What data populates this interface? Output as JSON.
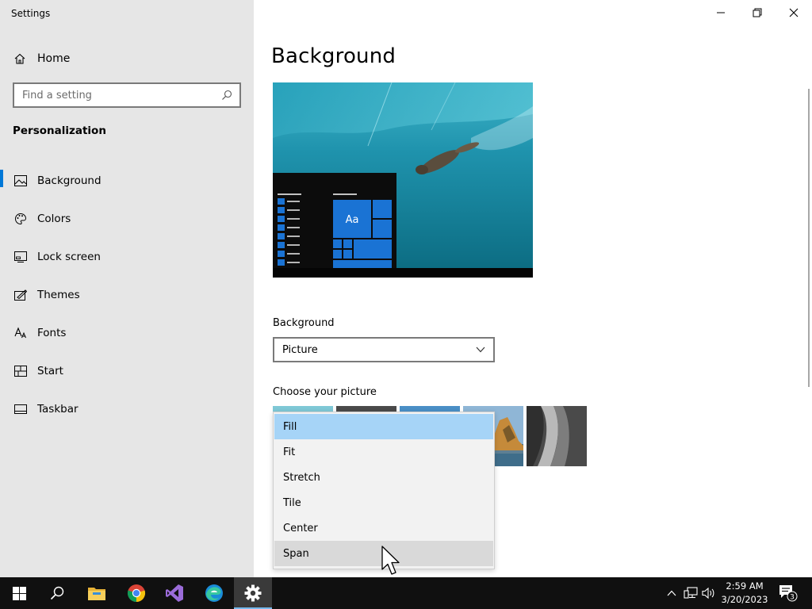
{
  "window": {
    "title": "Settings",
    "controls": [
      "minimize",
      "maximize",
      "close"
    ]
  },
  "sidebar": {
    "home_label": "Home",
    "search_placeholder": "Find a setting",
    "section_title": "Personalization",
    "items": [
      {
        "label": "Background",
        "icon": "picture-icon",
        "active": true
      },
      {
        "label": "Colors",
        "icon": "palette-icon",
        "active": false
      },
      {
        "label": "Lock screen",
        "icon": "lock-screen-icon",
        "active": false
      },
      {
        "label": "Themes",
        "icon": "themes-icon",
        "active": false
      },
      {
        "label": "Fonts",
        "icon": "fonts-icon",
        "active": false
      },
      {
        "label": "Start",
        "icon": "start-icon",
        "active": false
      },
      {
        "label": "Taskbar",
        "icon": "taskbar-icon",
        "active": false
      }
    ]
  },
  "main": {
    "title": "Background",
    "preview_tile_text": "Aa",
    "background_label": "Background",
    "background_value": "Picture",
    "choose_label": "Choose your picture"
  },
  "fit_dropdown": {
    "options": [
      "Fill",
      "Fit",
      "Stretch",
      "Tile",
      "Center",
      "Span"
    ],
    "selected": "Fill",
    "hovered": "Span"
  },
  "taskbar": {
    "apps": [
      "start-icon",
      "search-icon",
      "file-explorer-icon",
      "chrome-icon",
      "visual-studio-icon",
      "edge-icon",
      "settings-icon"
    ],
    "active_app": "settings-icon",
    "time": "2:59 AM",
    "date": "3/20/2023",
    "notification_count": "3"
  },
  "colors": {
    "accent": "#0078d7",
    "sidebar_bg": "#e6e6e6",
    "selected_option": "#a6d4f7",
    "taskbar_bg": "#101010"
  }
}
